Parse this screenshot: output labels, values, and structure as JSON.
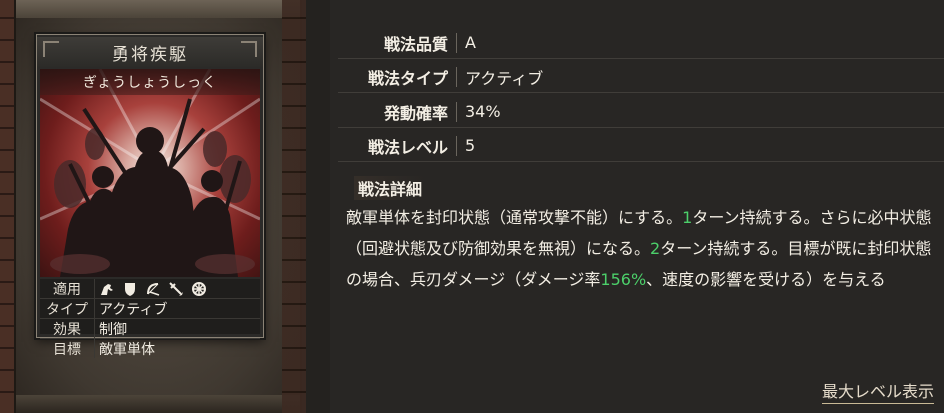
{
  "card": {
    "title": "勇将疾駆",
    "reading": "ぎょうしょうしっく",
    "rows": [
      {
        "key": "適用",
        "icons": [
          "cavalry-icon",
          "shield-icon",
          "bow-icon",
          "spear-icon",
          "siege-icon"
        ]
      },
      {
        "key": "タイプ",
        "value": "アクティブ"
      },
      {
        "key": "効果",
        "value": "制御"
      },
      {
        "key": "目標",
        "value": "敵軍単体"
      }
    ]
  },
  "details": {
    "quality_label": "戦法品質",
    "quality_value": "A",
    "type_label": "戦法タイプ",
    "type_value": "アクティブ",
    "rate_label": "発動確率",
    "rate_value": "34%",
    "level_label": "戦法レベル",
    "level_value": "5",
    "detail_title": "戦法詳細",
    "text": {
      "p1": "敵軍単体を封印状態（通常攻撃不能）にする。",
      "n1": "1",
      "p2": "ターン持続する。さらに必中状態（回避状態及び防御効果を無視）になる。",
      "n2": "2",
      "p3": "ターン持続する。目標が既に封印状態の場合、兵刃ダメージ（ダメージ率",
      "n3": "156%",
      "p4": "、速度の影響を受ける）を与える"
    },
    "highlight_color": "#4ccf6a"
  },
  "footer": {
    "max_level_link": "最大レベル表示"
  }
}
